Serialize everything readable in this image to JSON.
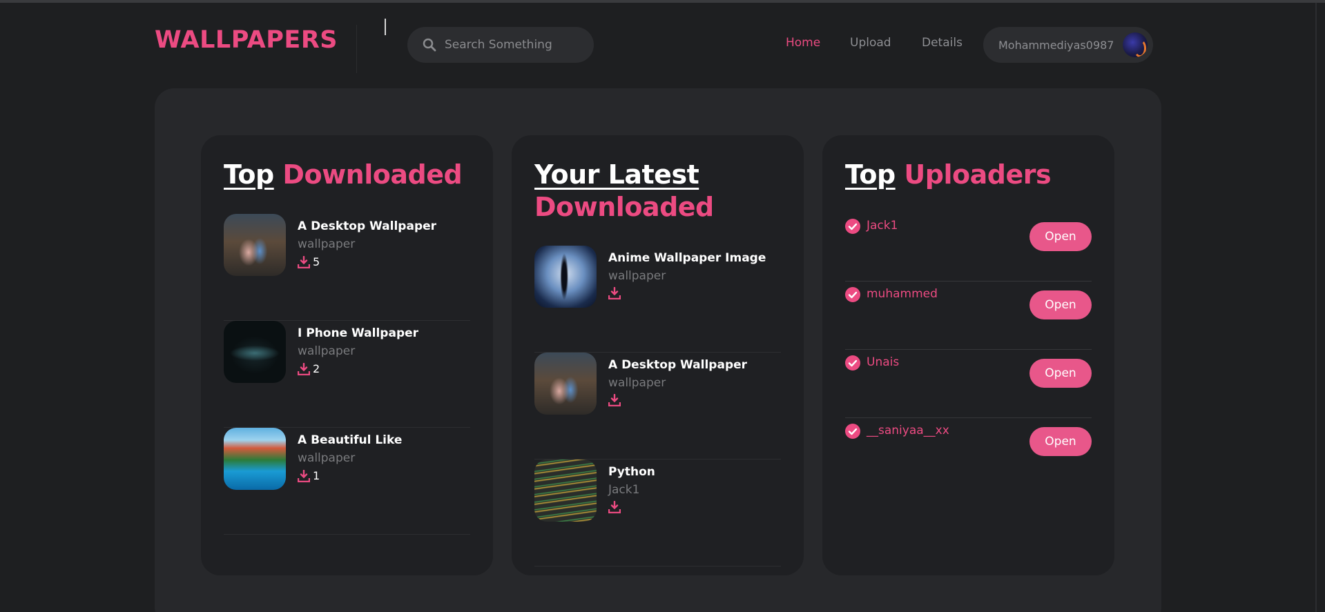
{
  "header": {
    "logo": "WALLPAPERS",
    "search_placeholder": "Search Something",
    "nav": [
      "Home",
      "Upload",
      "Details"
    ],
    "active_nav": "Home",
    "user": "Mohammediyas0987"
  },
  "colors": {
    "accent": "#ec4b82",
    "background": "#1e1f21",
    "panel": "#27282b",
    "card": "#1f2023"
  },
  "top_downloaded": {
    "title_white": "Top",
    "title_pink": "Downloaded",
    "items": [
      {
        "title": "A Desktop Wallpaper",
        "category": "wallpaper",
        "downloads": "5",
        "thumb": "desktop"
      },
      {
        "title": "I Phone Wallpaper",
        "category": "wallpaper",
        "downloads": "2",
        "thumb": "iphone"
      },
      {
        "title": "A Beautiful Like",
        "category": "wallpaper",
        "downloads": "1",
        "thumb": "beautiful"
      }
    ]
  },
  "latest_downloaded": {
    "title_white": "Your Latest",
    "title_pink": "Downloaded",
    "items": [
      {
        "title": "Anime Wallpaper Image",
        "category": "wallpaper",
        "thumb": "anime"
      },
      {
        "title": "A Desktop Wallpaper",
        "category": "wallpaper",
        "thumb": "desktop"
      },
      {
        "title": "Python",
        "category": "Jack1",
        "thumb": "python"
      }
    ]
  },
  "top_uploaders": {
    "title_white": "Top",
    "title_pink": "Uploaders",
    "button_label": "Open",
    "users": [
      "Jack1",
      "muhammed",
      "Unais",
      "__saniyaa__xx"
    ]
  }
}
